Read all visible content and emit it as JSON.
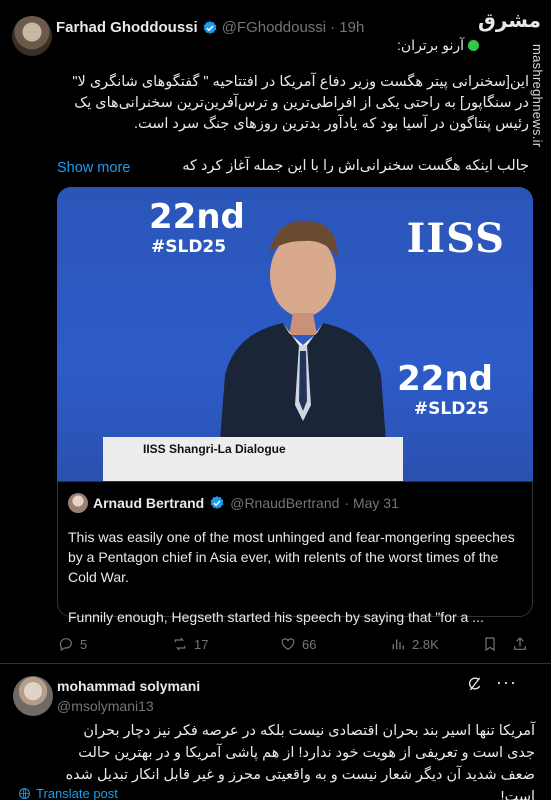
{
  "post": {
    "author_name": "Farhad Ghoddoussi",
    "author_handle": "@FGhoddoussi",
    "time": "· 19h",
    "quoted_author_line": "آرنو برتران:",
    "paragraph_1": "این[سخنرانی پیتر هگست وزیر دفاع آمریکا در  افتتاحیه \" گفتگوهای شانگری لا\" در سنگاپور] به راحتی یکی از افراطی‌ترین و ترس‌آفرین‌ترین سخنرانی‌های یک رئیس پنتاگون در آسیا بود که یادآور بدترین روزهای جنگ سرد است.",
    "paragraph_2": "جالب اینکه هگست سخنرانی‌اش را با این جمله آغاز کرد که",
    "show_more": "Show more",
    "media": {
      "event_number": "22nd",
      "event_tag": "#SLD25",
      "org": "IISS",
      "podium_label": "IISS Shangri-La Dialogue"
    },
    "quote": {
      "author_name": "Arnaud Bertrand",
      "author_handle": "@RnaudBertrand",
      "date": "· May 31",
      "paragraph_1": "This was easily one of the most unhinged and fear-mongering speeches by a Pentagon chief in Asia ever, with relents of the worst times of the Cold War.",
      "paragraph_2": "Funnily enough, Hegseth started his speech by saying that \"for a ..."
    },
    "actions": {
      "replies": "5",
      "reposts": "17",
      "likes": "66",
      "views": "2.8K"
    }
  },
  "reply": {
    "author_name": "mohammad solymani",
    "author_handle": "@msolymani13",
    "text": "آمریکا تنها اسیر بند بحران اقتصادی نیست بلکه در عرصه فکر نیز دچار بحران جدی است و تعریفی از هویت خود ندارد! از هم پاشی آمریکا و در بهترین حالت ضعف شدید آن دیگر شعار نیست و به واقعیتی  محرز و غیر قابل انکار تبدیل شده است!",
    "translate": "Translate post"
  },
  "watermark": {
    "logo": "مشرق",
    "site": "mashreghnews.ir"
  },
  "colors": {
    "background": "#000000",
    "text": "#e7e9ea",
    "muted": "#71767b",
    "link": "#1d9bf0",
    "verified": "#1d9bf0"
  }
}
